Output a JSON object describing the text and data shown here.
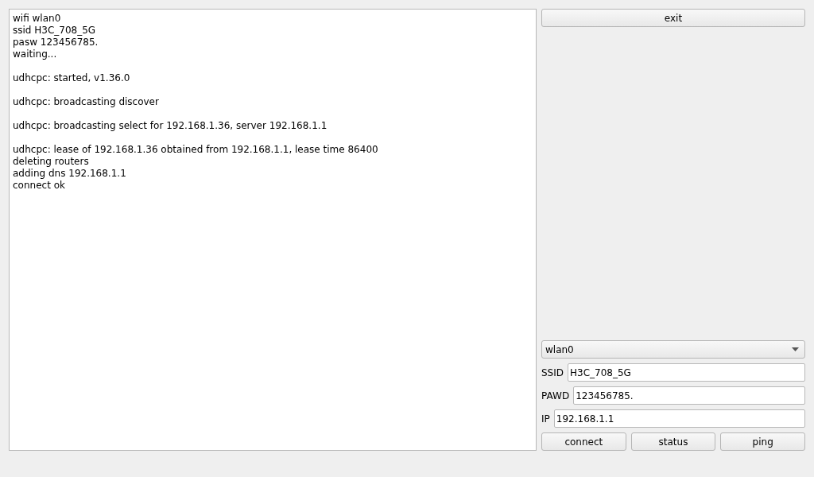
{
  "log": "wifi wlan0\nssid H3C_708_5G\npasw 123456785.\nwaiting...\n\nudhcpc: started, v1.36.0\n\nudhcpc: broadcasting discover\n\nudhcpc: broadcasting select for 192.168.1.36, server 192.168.1.1\n\nudhcpc: lease of 192.168.1.36 obtained from 192.168.1.1, lease time 86400\ndeleting routers\nadding dns 192.168.1.1\nconnect ok",
  "exit_button": "exit",
  "interface_select": {
    "value": "wlan0"
  },
  "fields": [
    {
      "label": "SSID",
      "value": "H3C_708_5G"
    },
    {
      "label": "PAWD",
      "value": "123456785."
    },
    {
      "label": "IP",
      "value": "192.168.1.1"
    }
  ],
  "buttons": [
    "connect",
    "status",
    "ping"
  ]
}
